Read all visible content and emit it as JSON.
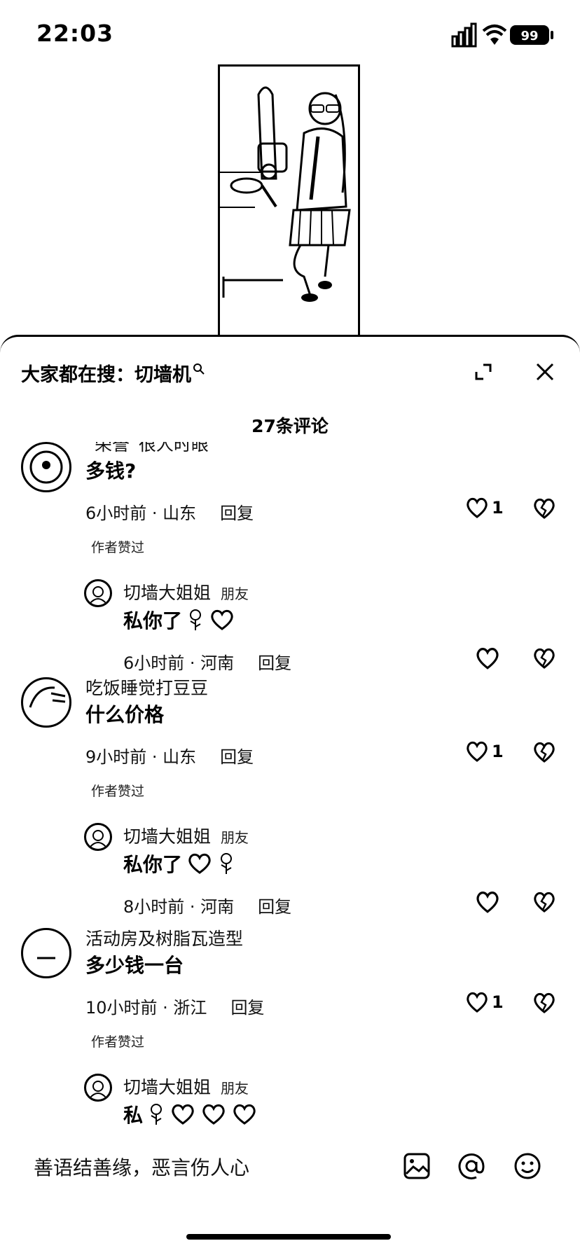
{
  "status_bar": {
    "time": "22:03",
    "battery": "99"
  },
  "header": {
    "search_prefix": "大家都在搜：",
    "search_term": "切墙机"
  },
  "comment_count": "27条评论",
  "comments": [
    {
      "username": "“荣誉”很人时眼",
      "text": "多钱?",
      "time": "6小时前 · 山东",
      "reply": "回复",
      "likes": "1",
      "author_liked": "作者赞过",
      "replies": [
        {
          "username": "切墙大姐姐",
          "tag": "朋友",
          "text": "私你了",
          "emojis": [
            "rose",
            "heart"
          ],
          "time": "6小时前 · 河南",
          "reply": "回复"
        }
      ]
    },
    {
      "username": "吃饭睡觉打豆豆",
      "text": "什么价格",
      "time": "9小时前 · 山东",
      "reply": "回复",
      "likes": "1",
      "author_liked": "作者赞过",
      "replies": [
        {
          "username": "切墙大姐姐",
          "tag": "朋友",
          "text": "私你了",
          "emojis": [
            "heart",
            "rose"
          ],
          "time": "8小时前 · 河南",
          "reply": "回复"
        }
      ]
    },
    {
      "username": "活动房及树脂瓦造型",
      "text": "多少钱一台",
      "time": "10小时前 · 浙江",
      "reply": "回复",
      "likes": "1",
      "author_liked": "作者赞过",
      "replies": [
        {
          "username": "切墙大姐姐",
          "tag": "朋友",
          "text": "私",
          "emojis": [
            "rose",
            "heart",
            "heart",
            "heart"
          ]
        }
      ]
    }
  ],
  "input": {
    "placeholder": "善语结善缘，恶言伤人心"
  },
  "icons": {
    "expand": "expand-icon",
    "close": "close-icon",
    "like": "heart-icon",
    "dislike": "broken-heart-icon",
    "image": "image-icon",
    "mention": "at-icon",
    "emoji": "emoji-icon"
  }
}
